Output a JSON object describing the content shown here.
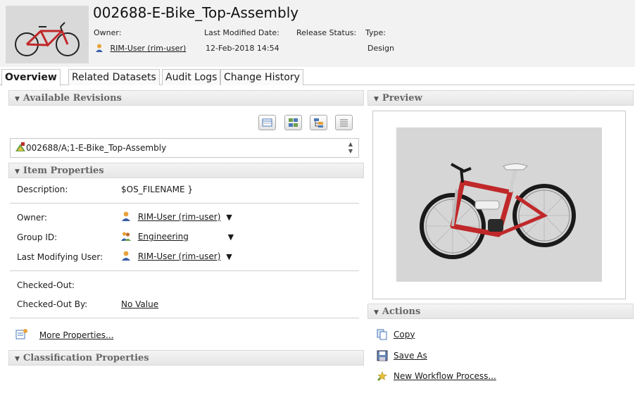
{
  "header": {
    "title": "002688-E-Bike_Top-Assembly",
    "owner_label": "Owner:",
    "owner_value": "RIM-User (rim-user)",
    "modified_label": "Last Modified Date:",
    "modified_value": "12-Feb-2018 14:54",
    "release_label": "Release Status:",
    "type_label": "Type:",
    "type_value": "Design"
  },
  "tabs": [
    {
      "label": "Overview",
      "active": true
    },
    {
      "label": "Related Datasets",
      "active": false
    },
    {
      "label": "Audit Logs",
      "active": false
    },
    {
      "label": "Change History",
      "active": false
    }
  ],
  "sections": {
    "available_revisions": "Available Revisions",
    "item_properties": "Item Properties",
    "classification_properties": "Classification Properties",
    "preview": "Preview",
    "actions": "Actions"
  },
  "revision": {
    "selected": "002688/A;1-E-Bike_Top-Assembly"
  },
  "properties": {
    "description_label": "Description:",
    "description_value": "$OS_FILENAME }",
    "owner_label": "Owner:",
    "owner_value": "RIM-User (rim-user)",
    "group_label": "Group ID:",
    "group_value": "Engineering",
    "last_mod_user_label": "Last Modifying User:",
    "last_mod_user_value": "RIM-User (rim-user)",
    "checked_out_label": "Checked-Out:",
    "checked_out_by_label": "Checked-Out By:",
    "checked_out_by_value": "No Value",
    "more_properties": "More Properties..."
  },
  "actions": {
    "copy": "Copy",
    "save_as": "Save As",
    "new_workflow": "New Workflow Process..."
  },
  "colors": {
    "bike_red": "#c0282a",
    "section_header_text": "#666666",
    "header_bg": "#f2f2f2",
    "user_icon_orange": "#e8a23a"
  }
}
